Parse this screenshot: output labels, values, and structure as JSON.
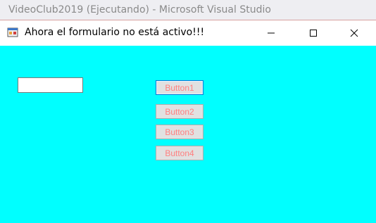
{
  "ide": {
    "title": "VideoClub2019 (Ejecutando) - Microsoft Visual Studio"
  },
  "form": {
    "title": "Ahora el formulario no está activo!!!",
    "icon": "windows-forms-app-icon",
    "window_controls": [
      "minimize-icon",
      "maximize-icon",
      "close-icon"
    ],
    "textbox": {
      "value": ""
    },
    "buttons": [
      {
        "label": "Button1",
        "focused": true
      },
      {
        "label": "Button2",
        "focused": false
      },
      {
        "label": "Button3",
        "focused": false
      },
      {
        "label": "Button4",
        "focused": false
      }
    ]
  },
  "colors": {
    "client_background": "#00ffff",
    "button_text": "#ff7f7f",
    "focus_border": "#0078d7"
  }
}
